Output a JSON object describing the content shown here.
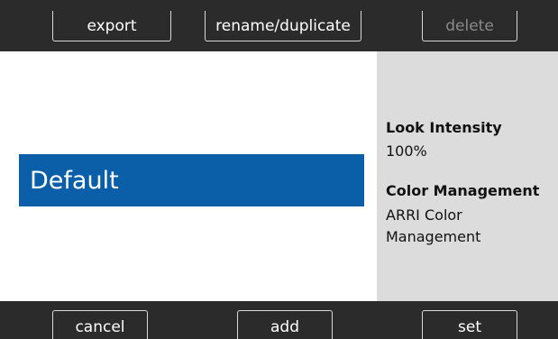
{
  "top_bar": {
    "export_label": "export",
    "rename_label": "rename/duplicate",
    "delete_label": "delete"
  },
  "list": {
    "selected_item": "Default"
  },
  "info": {
    "look_intensity_label": "Look Intensity",
    "look_intensity_value": "100%",
    "color_management_label": "Color Management",
    "color_management_value": "ARRI Color Management"
  },
  "bottom_bar": {
    "cancel_label": "cancel",
    "add_label": "add",
    "set_label": "set"
  },
  "colors": {
    "bar_background": "#2b2b2b",
    "selection": "#0a5fa8",
    "info_panel": "#dcdcdc"
  }
}
